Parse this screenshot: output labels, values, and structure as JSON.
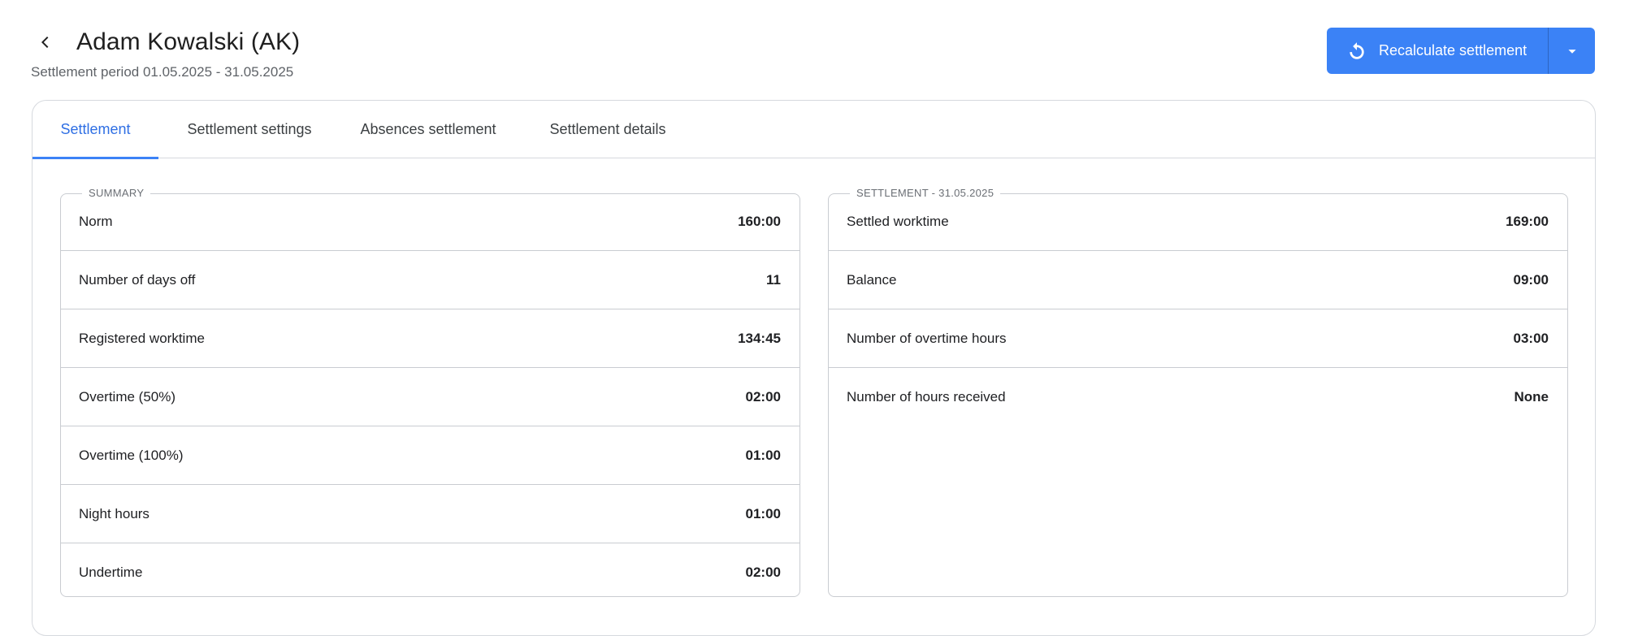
{
  "header": {
    "title": "Adam Kowalski (AK)",
    "subtitle": "Settlement period 01.05.2025 - 31.05.2025",
    "back_icon": "chevron-left-icon"
  },
  "actions": {
    "recalculate_label": "Recalculate settlement",
    "recalculate_icon": "refresh-icon",
    "dropdown_icon": "caret-down-icon",
    "accent_color": "#3b82f6"
  },
  "tabs": [
    {
      "label": "Settlement",
      "active": true
    },
    {
      "label": "Settlement settings",
      "active": false
    },
    {
      "label": "Absences settlement",
      "active": false
    },
    {
      "label": "Settlement details",
      "active": false
    }
  ],
  "summary": {
    "legend": "SUMMARY",
    "rows": [
      {
        "label": "Norm",
        "value": "160:00"
      },
      {
        "label": "Number of days off",
        "value": "11"
      },
      {
        "label": "Registered worktime",
        "value": "134:45"
      },
      {
        "label": "Overtime (50%)",
        "value": "02:00"
      },
      {
        "label": "Overtime (100%)",
        "value": "01:00"
      },
      {
        "label": "Night hours",
        "value": "01:00"
      },
      {
        "label": "Undertime",
        "value": "02:00"
      }
    ]
  },
  "settlement": {
    "legend": "SETTLEMENT - 31.05.2025",
    "rows": [
      {
        "label": "Settled worktime",
        "value": "169:00"
      },
      {
        "label": "Balance",
        "value": "09:00"
      },
      {
        "label": "Number of overtime hours",
        "value": "03:00"
      },
      {
        "label": "Number of hours received",
        "value": "None"
      }
    ]
  }
}
